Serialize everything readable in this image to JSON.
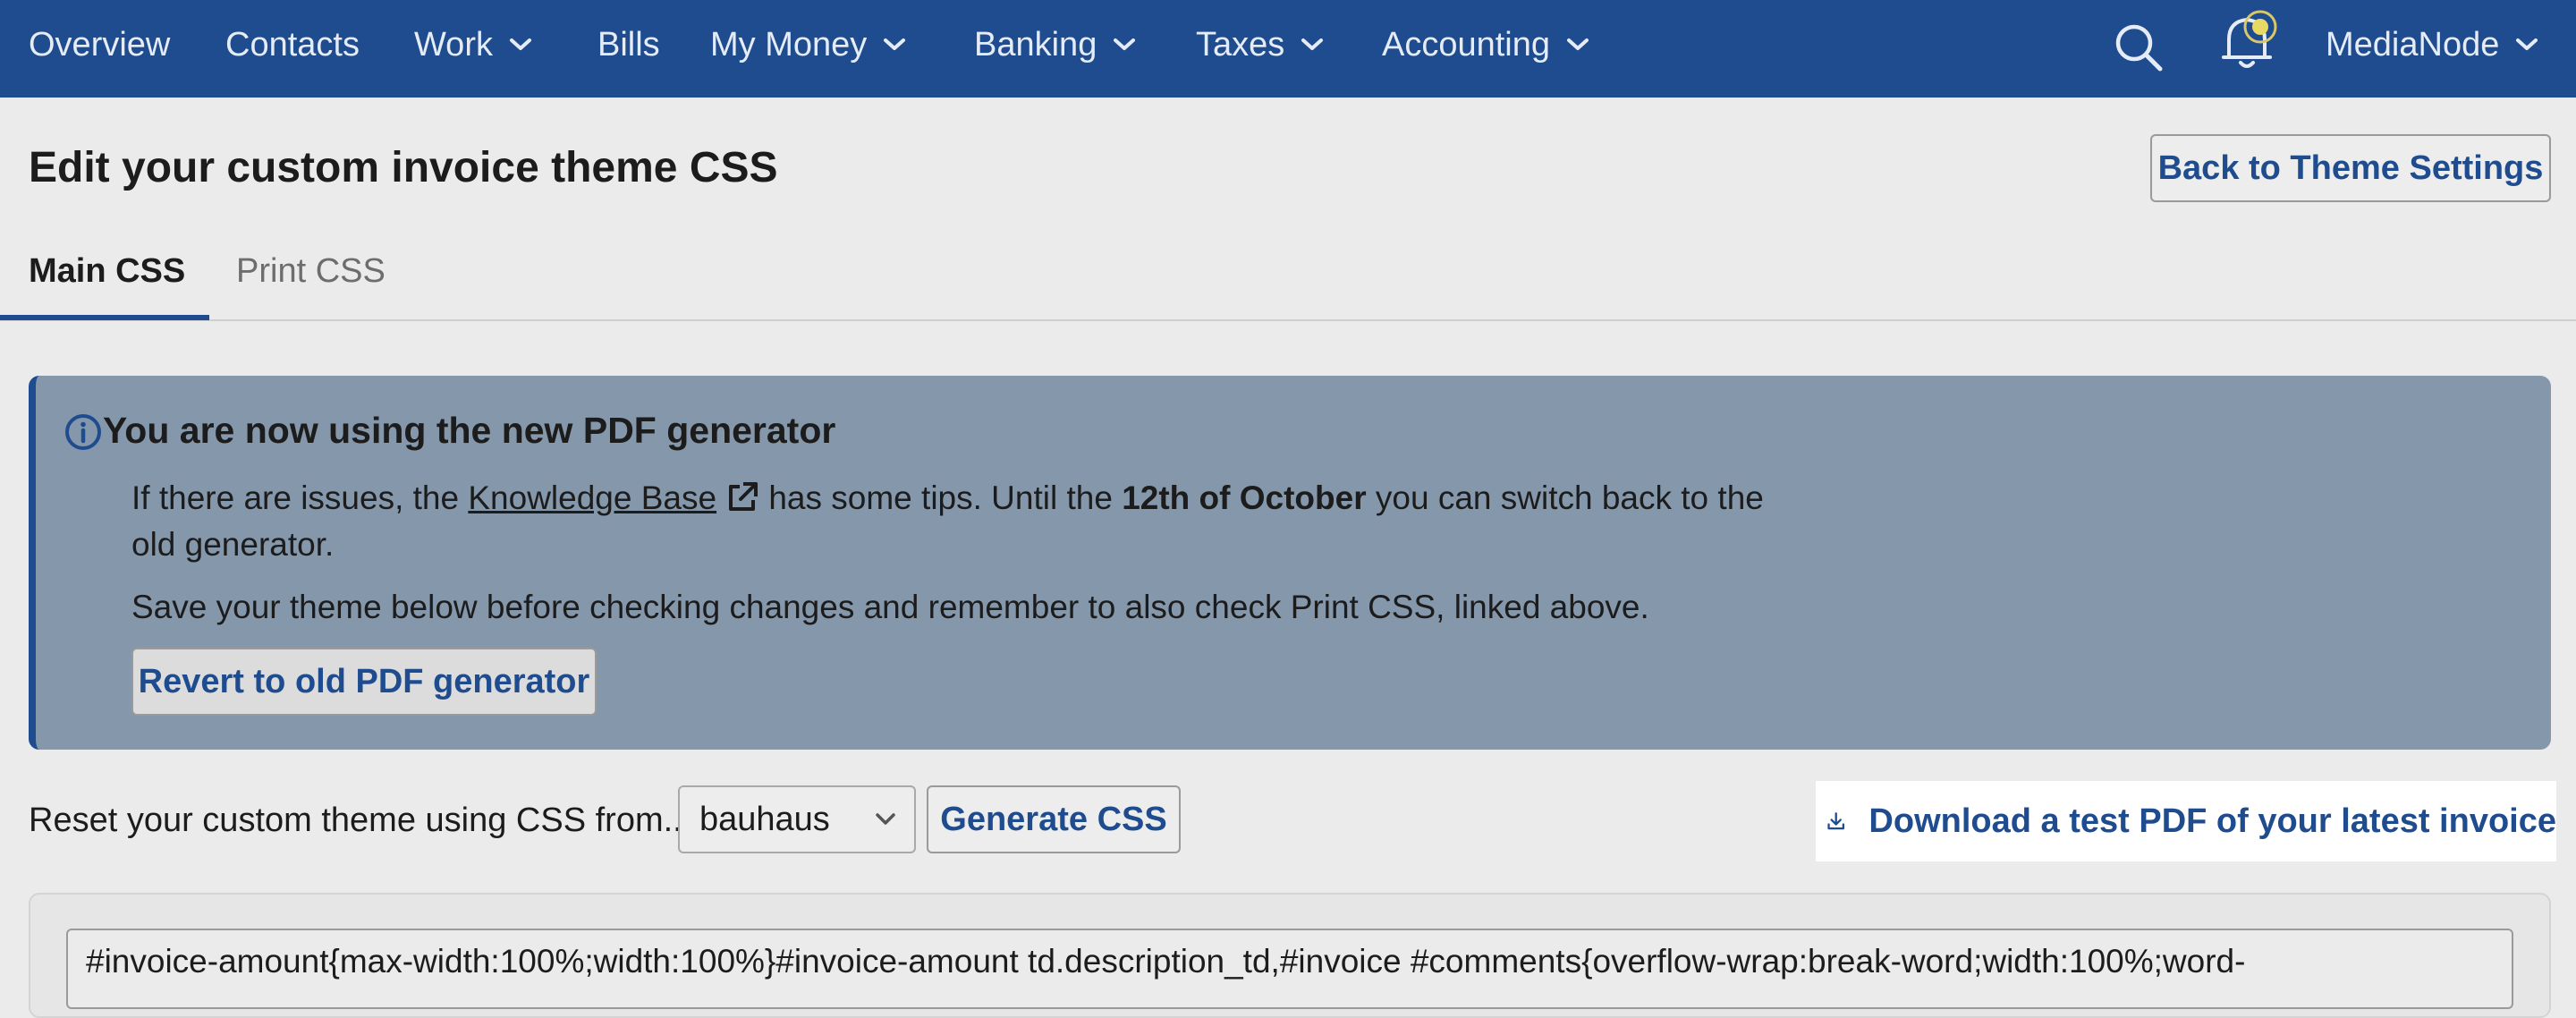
{
  "nav": {
    "items": [
      {
        "label": "Overview",
        "dropdown": false
      },
      {
        "label": "Contacts",
        "dropdown": false
      },
      {
        "label": "Work",
        "dropdown": true
      },
      {
        "label": "Bills",
        "dropdown": false
      },
      {
        "label": "My Money",
        "dropdown": true
      },
      {
        "label": "Banking",
        "dropdown": true
      },
      {
        "label": "Taxes",
        "dropdown": true
      },
      {
        "label": "Accounting",
        "dropdown": true
      }
    ],
    "account_label": "MediaNode",
    "icons": [
      "search-icon",
      "bell-icon",
      "chevron-down-icon"
    ]
  },
  "page": {
    "title": "Edit your custom invoice theme CSS",
    "back_button": "Back to Theme Settings"
  },
  "tabs": [
    {
      "label": "Main CSS",
      "active": true
    },
    {
      "label": "Print CSS",
      "active": false
    }
  ],
  "notice": {
    "title": "You are now using the new PDF generator",
    "line1_before": "If there are issues, the ",
    "link": "Knowledge Base",
    "line1_middle": " has some tips. Until the ",
    "date": "12th of October",
    "line1_after": " you can switch back to the",
    "line2": "old generator.",
    "line3": "Save your theme below before checking changes and remember to also check Print CSS, linked above.",
    "revert_button": "Revert to old PDF generator"
  },
  "reset": {
    "label": "Reset your custom theme using CSS from...",
    "selected_theme": "bauhaus",
    "generate_button": "Generate CSS",
    "download_link": "Download a test PDF of your latest invoice"
  },
  "editor": {
    "code": "#invoice-amount{max-width:100%;width:100%}#invoice-amount td.description_td,#invoice #comments{overflow-wrap:break-word;width:100%;word-"
  },
  "colors": {
    "nav_bg": "#1f4c8f",
    "accent": "#1f4c8f",
    "notice_bg": "#8497ab",
    "page_bg": "#ebebeb"
  }
}
